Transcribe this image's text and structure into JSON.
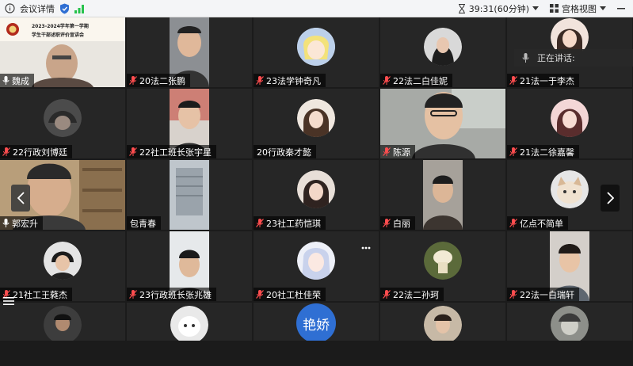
{
  "topbar": {
    "meeting_details": "会议详情",
    "timer": "39:31(60分钟)",
    "view_mode": "宫格视图"
  },
  "speaking_label": "正在讲话:",
  "avatar_text": "艳娇",
  "presentation_slide": {
    "line1": "2023-2024学年第一学期",
    "line2": "学生干部述职评价宣讲会"
  },
  "participants": [
    {
      "name": "魏成"
    },
    {
      "name": "20法二张鹏"
    },
    {
      "name": "23法学钟奇凡"
    },
    {
      "name": "22法二白佳妮"
    },
    {
      "name": "21法一于李杰"
    },
    {
      "name": "22行政刘博廷"
    },
    {
      "name": "22社工班长张宇星"
    },
    {
      "name": "20行政秦才懿"
    },
    {
      "name": "陈源"
    },
    {
      "name": "21法二徐嘉馨"
    },
    {
      "name": "郭宏升"
    },
    {
      "name": "包青春"
    },
    {
      "name": "23社工药恺琪"
    },
    {
      "name": "白丽"
    },
    {
      "name": "亿点不简单"
    },
    {
      "name": "21社工王蕤杰"
    },
    {
      "name": "23行政班长张兆雄"
    },
    {
      "name": "20社工杜佳荣"
    },
    {
      "name": "22法二孙珂"
    },
    {
      "name": "22法一白瑞轩"
    }
  ],
  "colors": {
    "topbar_bg": "#f4f5f7",
    "tile_bg": "#262626",
    "mic_muted": "#ff4d4f",
    "accent_blue": "#2f6fd3",
    "signal_green": "#27c24c"
  }
}
